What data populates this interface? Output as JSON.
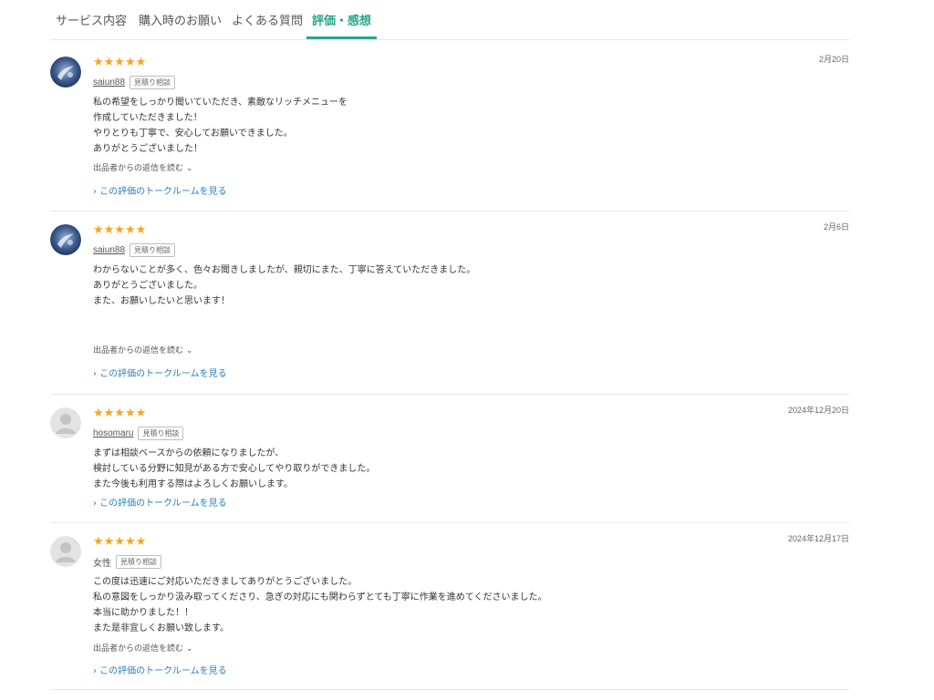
{
  "tabs": [
    "サービス内容",
    "購入時のお願い",
    "よくある質問",
    "評価・感想"
  ],
  "reviews": [
    {
      "stars": "★★★★★",
      "date": "2月20日",
      "user": "saiun88",
      "badge": "見積り相談",
      "body": "私の希望をしっかり聞いていただき、素敵なリッチメニューを\n作成していただきました！\nやりとりも丁寧で、安心してお願いできました。\nありがとうございました！",
      "reply": "出品者からの返信を読む ⌄",
      "talk": "› この評価のトークルームを見る"
    },
    {
      "stars": "★★★★★",
      "date": "2月6日",
      "user": "saiun88",
      "badge": "見積り相談",
      "body": "わからないことが多く、色々お聞きしましたが、親切にまた、丁寧に答えていただきました。\nありがとうございました。\nまた、お願いしたいと思います！",
      "reply": "出品者からの返信を読む ⌄",
      "talk": "› この評価のトークルームを見る"
    },
    {
      "stars": "★★★★★",
      "date": "2024年12月20日",
      "user": "hosomaru",
      "badge": "見積り相談",
      "body": "まずは相談ベースからの依頼になりましたが、\n検討している分野に知見がある方で安心してやり取りができました。\nまた今後も利用する際はよろしくお願いします。",
      "talk": "› この評価のトークルームを見る"
    },
    {
      "stars": "★★★★★",
      "date": "2024年12月17日",
      "user": "女性",
      "badge": "見積り相談",
      "body": "この度は迅速にご対応いただきましてありがとうございました。\n私の意図をしっかり汲み取ってくださり、急ぎの対応にも関わらずとても丁寧に作業を進めてくださいました。\n本当に助かりました！！\nまた是非宜しくお願い致します。",
      "reply": "出品者からの返信を読む ⌄",
      "talk": "› この評価のトークルームを見る"
    }
  ],
  "colors": {
    "accent": "#2aa58e",
    "star": "#f5a623",
    "link": "#2a7fc0"
  }
}
